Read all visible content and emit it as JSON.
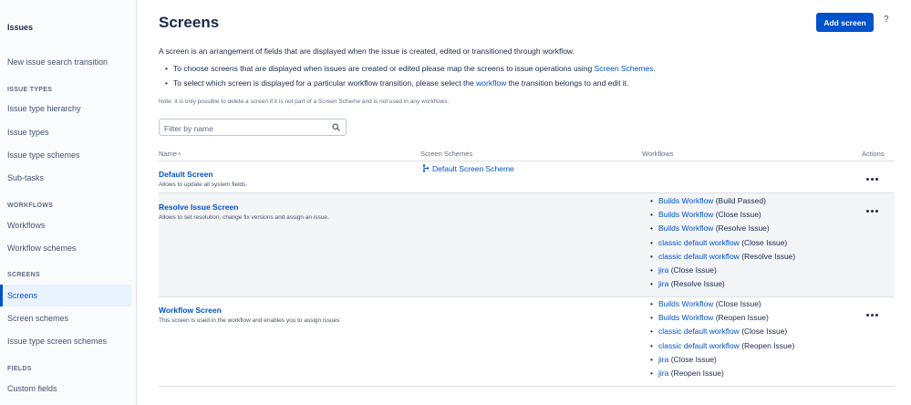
{
  "sidebar": {
    "title": "Issues",
    "top_item": "New issue search transition",
    "sections": [
      {
        "label": "ISSUE TYPES",
        "items": [
          "Issue type hierarchy",
          "Issue types",
          "Issue type schemes",
          "Sub-tasks"
        ]
      },
      {
        "label": "WORKFLOWS",
        "items": [
          "Workflows",
          "Workflow schemes"
        ]
      },
      {
        "label": "SCREENS",
        "items": [
          "Screens",
          "Screen schemes",
          "Issue type screen schemes"
        ]
      },
      {
        "label": "FIELDS",
        "items": [
          "Custom fields"
        ]
      }
    ],
    "active_item": "Screens"
  },
  "header": {
    "title": "Screens",
    "add_button": "Add screen",
    "help": "?"
  },
  "description": {
    "intro": "A screen is an arrangement of fields that are displayed when the issue is created, edited or transitioned through workflow.",
    "bullet1_pre": "To choose screens that are displayed when issues are created or edited please map the screens to issue operations using ",
    "bullet1_link": "Screen Schemes",
    "bullet1_post": ".",
    "bullet2_pre": "To select which screen is displayed for a particular workflow transition, please select the ",
    "bullet2_link": "workflow",
    "bullet2_post": " the transition belongs to and edit it.",
    "note": "Note: it is only possible to delete a screen if it is not part of a Screen Scheme and is not used in any workflows."
  },
  "filter": {
    "placeholder": "Filter by name"
  },
  "table": {
    "headers": {
      "name": "Name",
      "sort_indicator": "˄",
      "schemes": "Screen Schemes",
      "workflows": "Workflows",
      "actions": "Actions"
    },
    "rows": [
      {
        "name": "Default Screen",
        "description": "Allows to update all system fields.",
        "scheme": "Default Screen Scheme",
        "workflows": []
      },
      {
        "name": "Resolve Issue Screen",
        "description": "Allows to set resolution, change fix versions and assign an issue.",
        "scheme": "",
        "workflows": [
          {
            "link": "Builds Workflow",
            "transition": "(Build Passed)"
          },
          {
            "link": "Builds Workflow",
            "transition": "(Close Issue)"
          },
          {
            "link": "Builds Workflow",
            "transition": "(Resolve Issue)"
          },
          {
            "link": "classic default workflow",
            "transition": "(Close Issue)"
          },
          {
            "link": "classic default workflow",
            "transition": "(Resolve Issue)"
          },
          {
            "link": "jira",
            "transition": "(Close Issue)"
          },
          {
            "link": "jira",
            "transition": "(Resolve Issue)"
          }
        ]
      },
      {
        "name": "Workflow Screen",
        "description": "This screen is used in the workflow and enables you to assign issues",
        "scheme": "",
        "workflows": [
          {
            "link": "Builds Workflow",
            "transition": "(Close Issue)"
          },
          {
            "link": "Builds Workflow",
            "transition": "(Reopen Issue)"
          },
          {
            "link": "classic default workflow",
            "transition": "(Close Issue)"
          },
          {
            "link": "classic default workflow",
            "transition": "(Reopen Issue)"
          },
          {
            "link": "jira",
            "transition": "(Close Issue)"
          },
          {
            "link": "jira",
            "transition": "(Reopen Issue)"
          }
        ]
      }
    ]
  },
  "icons": {
    "search": "search-icon",
    "scheme": "screen-scheme-icon",
    "more": "more-actions-icon"
  },
  "colors": {
    "accent": "#0052cc",
    "sidebar_bg": "#fafbfc",
    "active_bg": "#e9f2ff",
    "row_shade": "#f4f5f7"
  }
}
